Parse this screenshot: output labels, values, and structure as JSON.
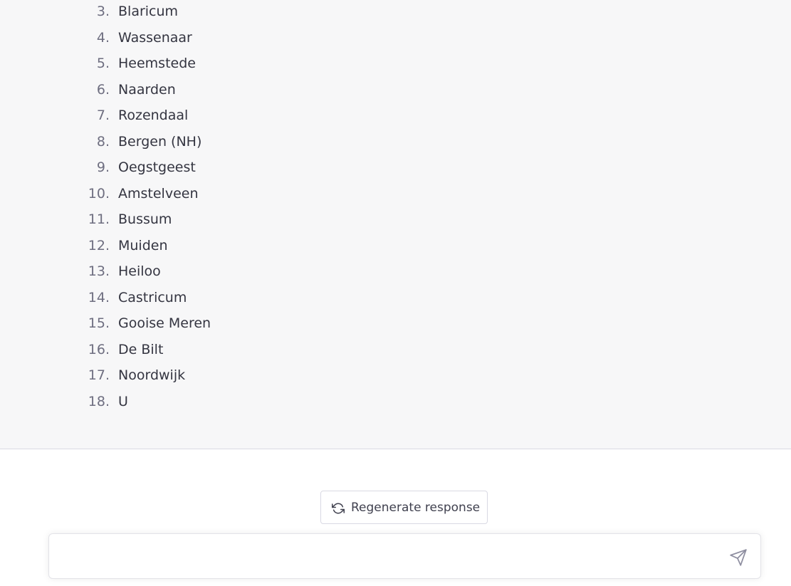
{
  "response": {
    "items": [
      {
        "num": "3.",
        "text": "Blaricum"
      },
      {
        "num": "4.",
        "text": "Wassenaar"
      },
      {
        "num": "5.",
        "text": "Heemstede"
      },
      {
        "num": "6.",
        "text": "Naarden"
      },
      {
        "num": "7.",
        "text": "Rozendaal"
      },
      {
        "num": "8.",
        "text": "Bergen (NH)"
      },
      {
        "num": "9.",
        "text": "Oegstgeest"
      },
      {
        "num": "10.",
        "text": "Amstelveen"
      },
      {
        "num": "11.",
        "text": "Bussum"
      },
      {
        "num": "12.",
        "text": "Muiden"
      },
      {
        "num": "13.",
        "text": "Heiloo"
      },
      {
        "num": "14.",
        "text": "Castricum"
      },
      {
        "num": "15.",
        "text": "Gooise Meren"
      },
      {
        "num": "16.",
        "text": "De Bilt"
      },
      {
        "num": "17.",
        "text": "Noordwijk"
      },
      {
        "num": "18.",
        "text": "U"
      }
    ]
  },
  "controls": {
    "regenerate_label": "Regenerate response",
    "regenerate_icon": "refresh-icon",
    "send_icon": "paper-plane-icon"
  },
  "composer": {
    "value": "",
    "placeholder": ""
  },
  "colors": {
    "chat_background": "#f7f7f8",
    "text": "#343541",
    "muted": "#6e6e80",
    "border": "#d9d9e3"
  }
}
